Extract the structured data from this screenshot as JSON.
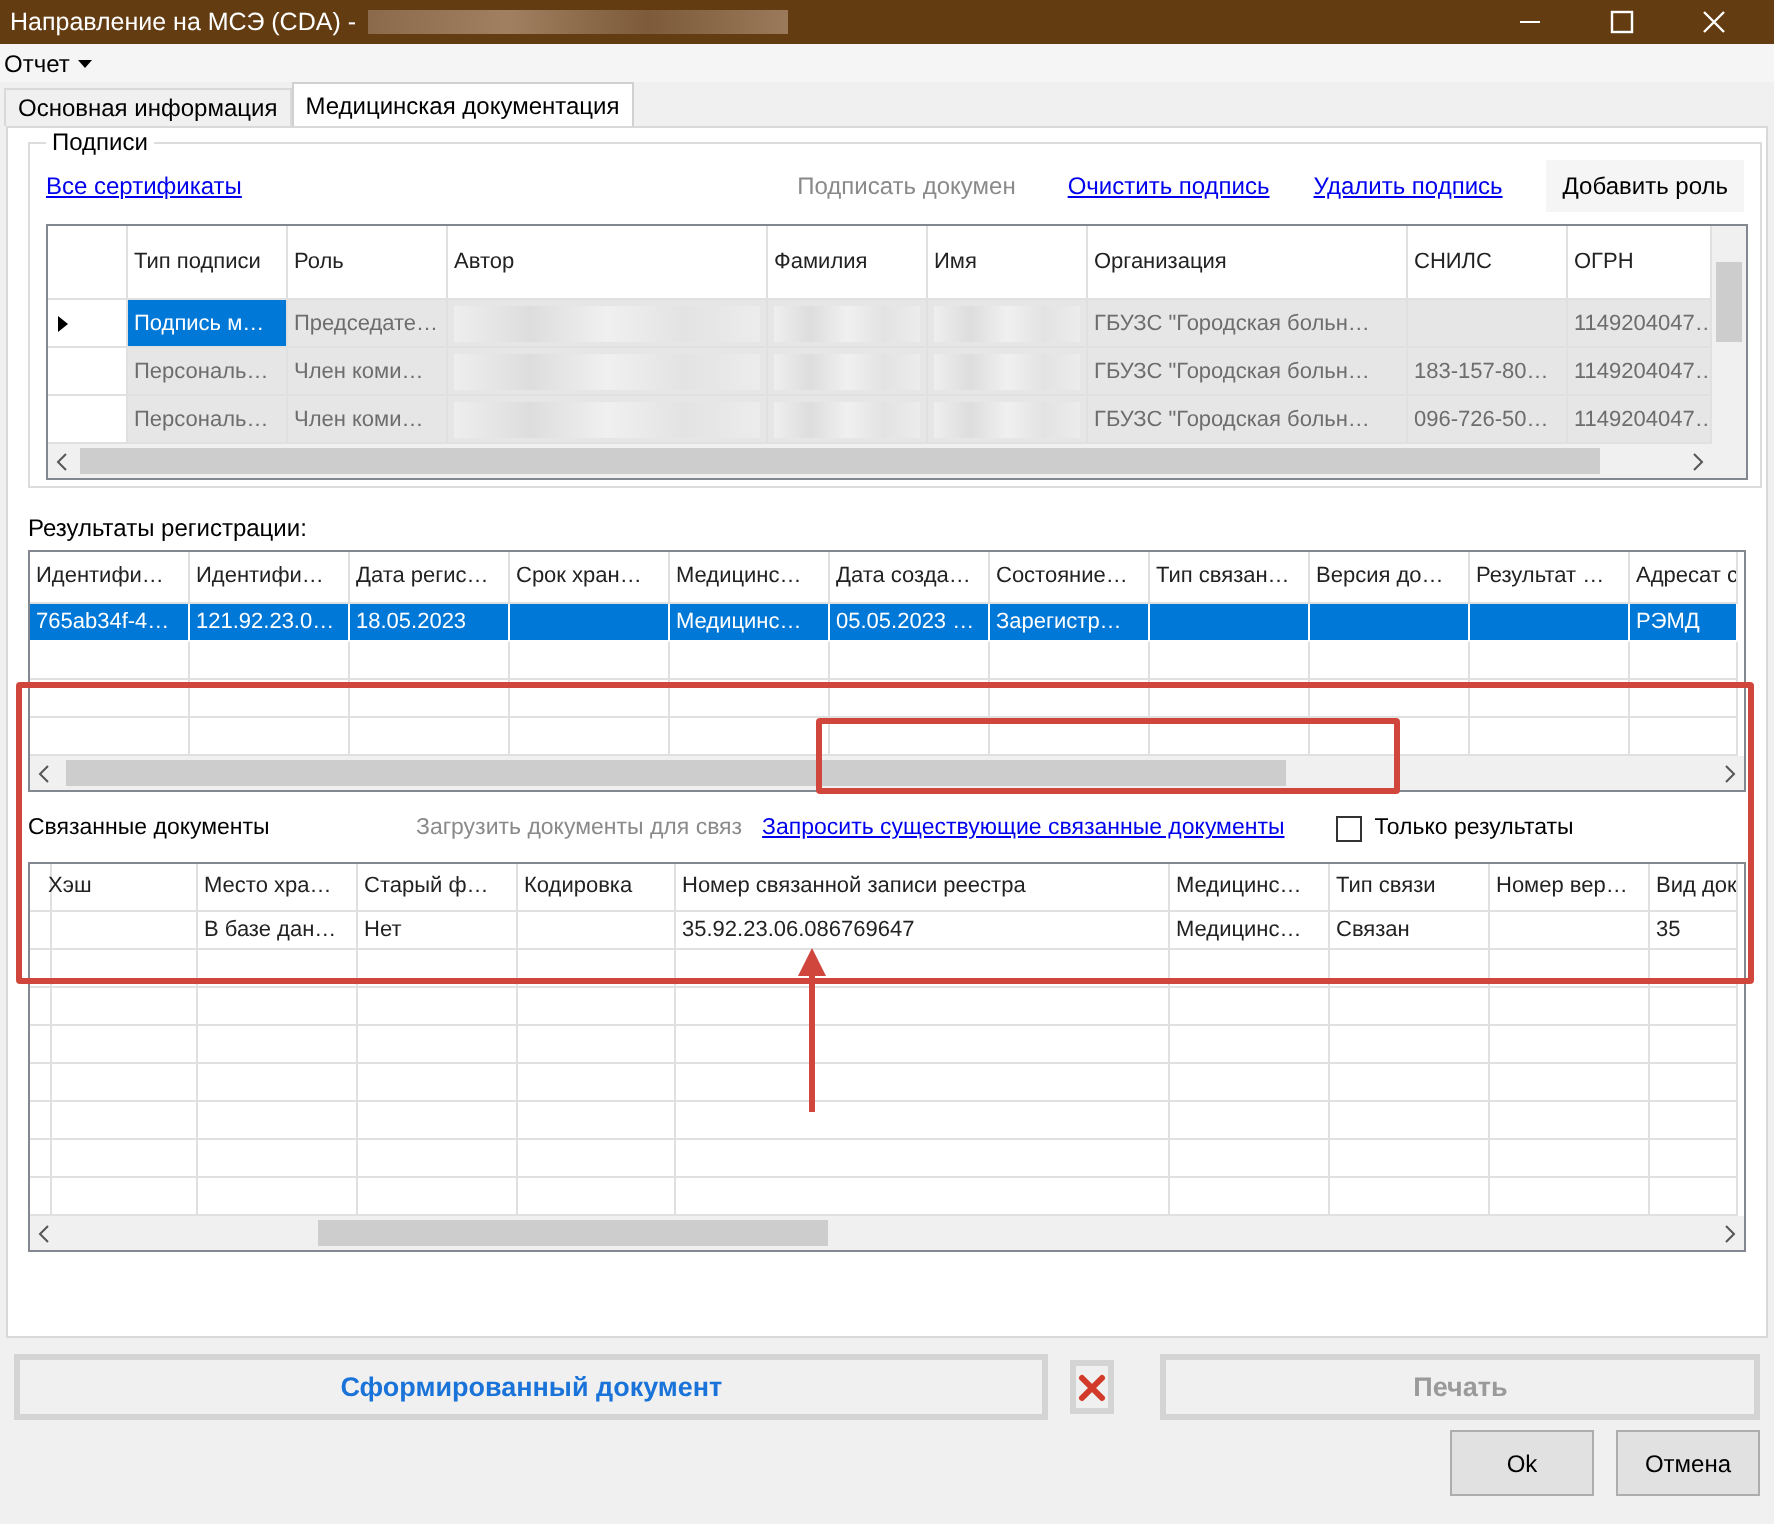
{
  "window": {
    "title": "Направление на МСЭ (CDA) -"
  },
  "menu": [
    {
      "label": "Отчет"
    }
  ],
  "tabs": [
    {
      "label": "Основная информация",
      "selected": false
    },
    {
      "label": "Медицинская документация",
      "selected": true
    }
  ],
  "signatures": {
    "title": "Подписи",
    "actions": [
      {
        "kind": "link",
        "label": "Все сертификаты",
        "disabled": false
      },
      {
        "kind": "text",
        "label": "Подписать докумен",
        "disabled": true
      },
      {
        "kind": "link",
        "label": "Очистить подпись",
        "disabled": false
      },
      {
        "kind": "link",
        "label": "Удалить подпись",
        "disabled": false
      },
      {
        "kind": "button",
        "label": "Добавить роль",
        "disabled": false
      }
    ],
    "columns": [
      "Тип подписи",
      "Роль",
      "Автор",
      "Фамилия",
      "Имя",
      "Организация",
      "СНИЛС",
      "ОГРН"
    ],
    "rows": [
      {
        "selected": true,
        "cells": [
          "Подпись м…",
          "Председате…",
          null,
          null,
          null,
          "ГБУЗС \"Городская больн…",
          null,
          "1149204047…"
        ]
      },
      {
        "selected": false,
        "cells": [
          "Персональ…",
          "Член коми…",
          null,
          null,
          null,
          "ГБУЗС \"Городская больн…",
          "183-157-80…",
          "1149204047…"
        ]
      },
      {
        "selected": false,
        "cells": [
          "Персональ…",
          "Член коми…",
          null,
          null,
          null,
          "ГБУЗС \"Городская больн…",
          "096-726-50…",
          "1149204047…"
        ]
      }
    ]
  },
  "registration": {
    "title": "Результаты регистрации:",
    "columns": [
      "Идентифи…",
      "Идентифи…",
      "Дата регис…",
      "Срок хран…",
      "Медицинс…",
      "Дата созда…",
      "Состояние…",
      "Тип связан…",
      "Версия до…",
      "Результат …",
      "Адресат с"
    ],
    "rows": [
      {
        "selected": true,
        "cells": [
          "765ab34f-4…",
          "121.92.23.0…",
          "18.05.2023",
          null,
          "Медицинс…",
          "05.05.2023 …",
          "Зарегистр…",
          null,
          null,
          null,
          "РЭМД"
        ]
      }
    ]
  },
  "related": {
    "title": "Связанные документы",
    "load_button": {
      "label": "Загрузить документы для связ",
      "disabled": true
    },
    "request_link": {
      "label": "Запросить существующие связанные документы"
    },
    "only_results": {
      "label": "Только результаты",
      "checked": false
    },
    "columns": [
      "Хэш",
      "Место хра…",
      "Старый ф…",
      "Кодировка",
      "Номер связанной записи реестра",
      "Медицинс…",
      "Тип связи",
      "Номер вер…",
      "Вид док"
    ],
    "rows": [
      {
        "cells": [
          null,
          "В базе дан…",
          "Нет",
          null,
          "35.92.23.06.086769647",
          "Медицинс…",
          "Связан",
          null,
          "35"
        ]
      }
    ]
  },
  "footer": {
    "generated_button": {
      "label": "Сформированный документ"
    },
    "print_button": {
      "label": "Печать",
      "disabled": true
    },
    "buttons": [
      "Ok",
      "Отмена"
    ]
  }
}
